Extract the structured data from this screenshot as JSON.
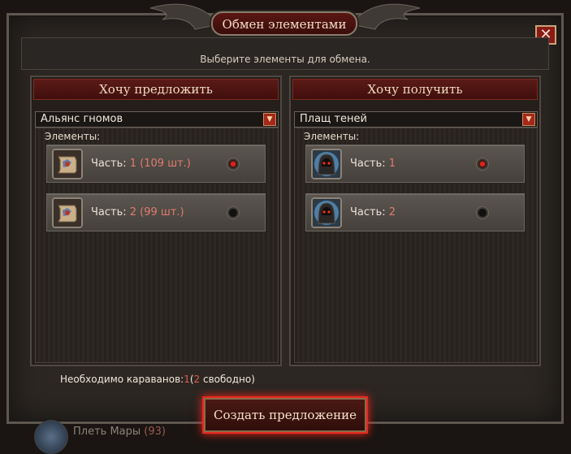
{
  "dialog": {
    "title": "Обмен элементами",
    "close_label": "✕",
    "subtitle": "Выберите элементы для обмена."
  },
  "offer_panel": {
    "heading": "Хочу предложить",
    "selected_set": "Альянс гномов",
    "items_label": "Элементы:",
    "items": [
      {
        "name": "Часть:",
        "part": "1 (109 шт.)",
        "selected": true,
        "icon": "scroll-map-icon"
      },
      {
        "name": "Часть:",
        "part": "2 (99 шт.)",
        "selected": false,
        "icon": "scroll-map-icon"
      }
    ]
  },
  "receive_panel": {
    "heading": "Хочу получить",
    "selected_set": "Плащ теней",
    "items_label": "Элементы:",
    "items": [
      {
        "name": "Часть:",
        "part": "1",
        "selected": true,
        "icon": "hooded-figure-icon"
      },
      {
        "name": "Часть:",
        "part": "2",
        "selected": false,
        "icon": "hooded-figure-icon"
      }
    ]
  },
  "caravans": {
    "label": "Необходимо караванов:",
    "required": "1",
    "open_paren": "(",
    "free": "2",
    "free_label": "свободно)"
  },
  "create_button": "Создать предложение",
  "background_user": {
    "name": "Плеть Мары",
    "count": "(93)"
  },
  "colors": {
    "accent_red": "#e42a22",
    "count_red": "#e07b6e",
    "panel_header": "#5c1a16"
  }
}
